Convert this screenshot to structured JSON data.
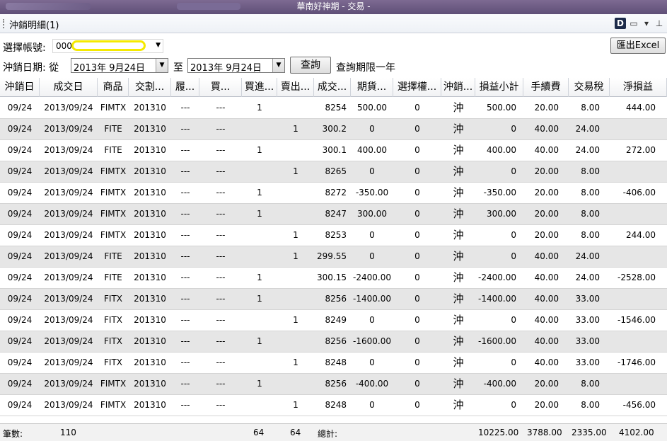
{
  "window": {
    "title": "華南好神期 - 交易 -"
  },
  "panel": {
    "title": "沖銷明細(1)",
    "d_icon": "D"
  },
  "account": {
    "label": "選擇帳號:",
    "value": "000"
  },
  "export_label": "匯出Excel",
  "date_range": {
    "label": "沖銷日期: 從",
    "from": "2013年  9月24日",
    "to_label": "至",
    "to": "2013年  9月24日",
    "query_button": "查詢",
    "note": "查詢期限一年"
  },
  "columns": [
    "沖銷日",
    "成交日",
    "商品",
    "交割...",
    "履...",
    "買...",
    "買進...",
    "賣出...",
    "成交...",
    "期貨...",
    "選擇權...",
    "沖銷...",
    "損益小計",
    "手續費",
    "交易稅",
    "淨損益"
  ],
  "rows": [
    [
      "09/24",
      "2013/09/24",
      "FIMTX",
      "201310",
      "---",
      "---",
      "1",
      "",
      "8254",
      "500.00",
      "0",
      "沖",
      "500.00",
      "20.00",
      "8.00",
      "444.00"
    ],
    [
      "09/24",
      "2013/09/24",
      "FITE",
      "201310",
      "---",
      "---",
      "",
      "1",
      "300.2",
      "0",
      "0",
      "沖",
      "0",
      "40.00",
      "24.00",
      ""
    ],
    [
      "09/24",
      "2013/09/24",
      "FITE",
      "201310",
      "---",
      "---",
      "1",
      "",
      "300.1",
      "400.00",
      "0",
      "沖",
      "400.00",
      "40.00",
      "24.00",
      "272.00"
    ],
    [
      "09/24",
      "2013/09/24",
      "FIMTX",
      "201310",
      "---",
      "---",
      "",
      "1",
      "8265",
      "0",
      "0",
      "沖",
      "0",
      "20.00",
      "8.00",
      ""
    ],
    [
      "09/24",
      "2013/09/24",
      "FIMTX",
      "201310",
      "---",
      "---",
      "1",
      "",
      "8272",
      "-350.00",
      "0",
      "沖",
      "-350.00",
      "20.00",
      "8.00",
      "-406.00"
    ],
    [
      "09/24",
      "2013/09/24",
      "FIMTX",
      "201310",
      "---",
      "---",
      "1",
      "",
      "8247",
      "300.00",
      "0",
      "沖",
      "300.00",
      "20.00",
      "8.00",
      ""
    ],
    [
      "09/24",
      "2013/09/24",
      "FIMTX",
      "201310",
      "---",
      "---",
      "",
      "1",
      "8253",
      "0",
      "0",
      "沖",
      "0",
      "20.00",
      "8.00",
      "244.00"
    ],
    [
      "09/24",
      "2013/09/24",
      "FITE",
      "201310",
      "---",
      "---",
      "",
      "1",
      "299.55",
      "0",
      "0",
      "沖",
      "0",
      "40.00",
      "24.00",
      ""
    ],
    [
      "09/24",
      "2013/09/24",
      "FITE",
      "201310",
      "---",
      "---",
      "1",
      "",
      "300.15",
      "-2400.00",
      "0",
      "沖",
      "-2400.00",
      "40.00",
      "24.00",
      "-2528.00"
    ],
    [
      "09/24",
      "2013/09/24",
      "FITX",
      "201310",
      "---",
      "---",
      "1",
      "",
      "8256",
      "-1400.00",
      "0",
      "沖",
      "-1400.00",
      "40.00",
      "33.00",
      ""
    ],
    [
      "09/24",
      "2013/09/24",
      "FITX",
      "201310",
      "---",
      "---",
      "",
      "1",
      "8249",
      "0",
      "0",
      "沖",
      "0",
      "40.00",
      "33.00",
      "-1546.00"
    ],
    [
      "09/24",
      "2013/09/24",
      "FITX",
      "201310",
      "---",
      "---",
      "1",
      "",
      "8256",
      "-1600.00",
      "0",
      "沖",
      "-1600.00",
      "40.00",
      "33.00",
      ""
    ],
    [
      "09/24",
      "2013/09/24",
      "FITX",
      "201310",
      "---",
      "---",
      "",
      "1",
      "8248",
      "0",
      "0",
      "沖",
      "0",
      "40.00",
      "33.00",
      "-1746.00"
    ],
    [
      "09/24",
      "2013/09/24",
      "FIMTX",
      "201310",
      "---",
      "---",
      "1",
      "",
      "8256",
      "-400.00",
      "0",
      "沖",
      "-400.00",
      "20.00",
      "8.00",
      ""
    ],
    [
      "09/24",
      "2013/09/24",
      "FIMTX",
      "201310",
      "---",
      "---",
      "",
      "1",
      "8248",
      "0",
      "0",
      "沖",
      "0",
      "20.00",
      "8.00",
      "-456.00"
    ]
  ],
  "footer": {
    "count_label": "筆數:",
    "count": "110",
    "buy_total": "64",
    "sell_total": "64",
    "total_label": "總計:",
    "pnl_total": "10225.00",
    "fee_total": "3788.00",
    "tax_total": "2335.00",
    "net_total": "4102.00"
  },
  "colors": {
    "alt_row": "#e6e6e6",
    "highlight": "#f5ea00"
  }
}
